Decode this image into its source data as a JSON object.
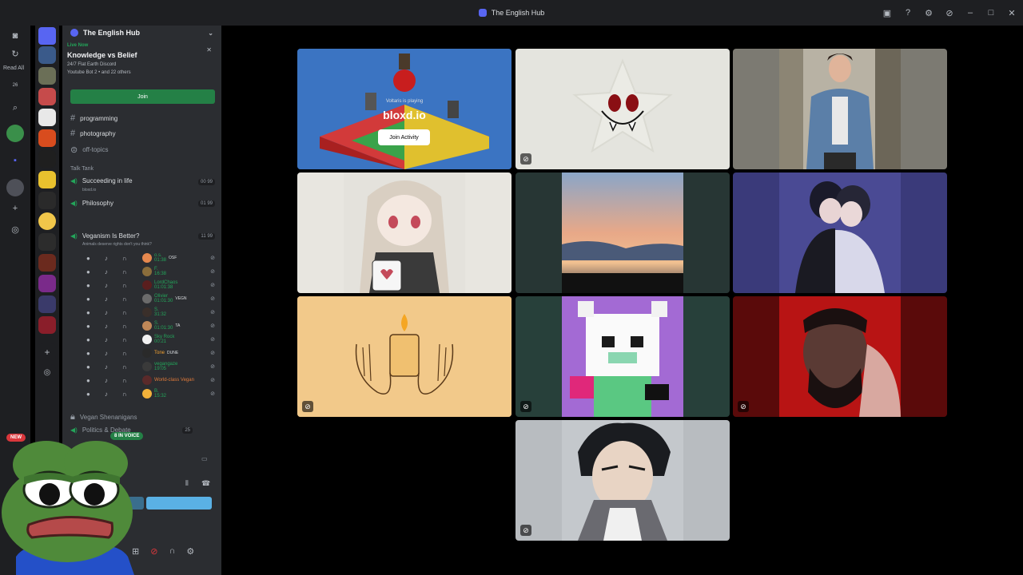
{
  "window": {
    "title": "The English Hub"
  },
  "rail": {
    "read_all": "Read All",
    "mentions_count": "26"
  },
  "sidebar": {
    "server_name": "The English Hub",
    "live": {
      "status": "Live Now",
      "title": "Knowledge vs Belief",
      "subtitle": "24/7 Flat Earth Discord",
      "people": "Youtube Bot 2 • and 22 others",
      "join_label": "Join"
    },
    "text_channels": [
      {
        "name": "programming"
      },
      {
        "name": "photography"
      },
      {
        "name": "off-topics"
      }
    ],
    "category": "Talk Tank",
    "voice_channels": [
      {
        "name": "Succeeding in life",
        "sub": "bloxd.io",
        "count": "00 99"
      },
      {
        "name": "Philosophy",
        "count": "01 99"
      },
      {
        "name": "Veganism Is Better?",
        "sub": "Animals deserve rights don't you think?",
        "count": "11 99"
      }
    ],
    "voice_users": [
      {
        "name": "o.s.",
        "time": "01:38",
        "tag": "OSF",
        "color": "#e6884e"
      },
      {
        "name": "F.",
        "time": "16:38",
        "tag": "",
        "color": "#8a6d3b"
      },
      {
        "name": "LordChaos",
        "time": "01:01:38",
        "tag": "",
        "color": "#5a1e1e"
      },
      {
        "name": "Olivier",
        "time": "01:01:30",
        "tag": "VEGN",
        "color": "#6b6b6b"
      },
      {
        "name": "S.",
        "time": "31:32",
        "tag": "",
        "color": "#3a2f2a"
      },
      {
        "name": "S.",
        "time": "01:01:30",
        "tag": "TA",
        "color": "#c08858"
      },
      {
        "name": "Sky Rock",
        "time": "00:21",
        "tag": "",
        "color": "#f2f2f2"
      },
      {
        "name": "Tone",
        "time": "",
        "tag": "DUNE",
        "color": "#2a2a2a"
      },
      {
        "name": "vegangaze",
        "time": "19:05",
        "tag": "",
        "color": "#3a3a3a"
      },
      {
        "name": "World-class Vegan",
        "time": "",
        "tag": "",
        "color": "#5a2a2a"
      },
      {
        "name": "B.",
        "time": "15:32",
        "tag": "",
        "color": "#f2b13a"
      }
    ],
    "more_channels": [
      {
        "name": "Vegan Shenanigans"
      },
      {
        "name": "Politics & Debate",
        "count": "25"
      }
    ],
    "new_badge": "NEW",
    "in_voice": "8 IN VOICE"
  },
  "activity": {
    "playing_label": "Voltaris is playing",
    "game_name": "bloxd.io",
    "join_label": "Join Activity"
  },
  "colors": {
    "accent_green": "#248046",
    "brand": "#5865f2"
  }
}
